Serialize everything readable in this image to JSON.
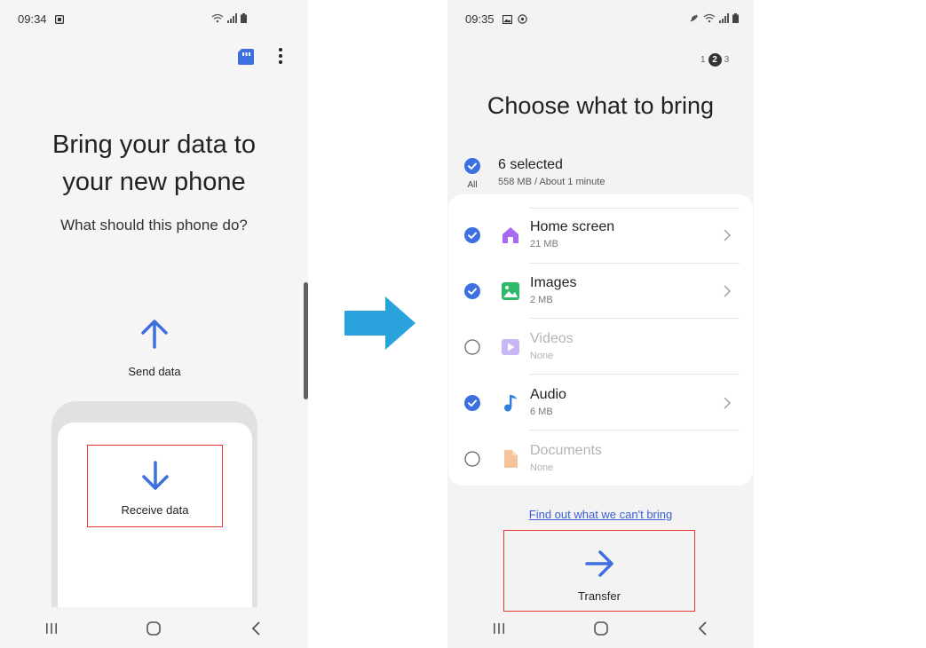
{
  "left_phone": {
    "status_time": "09:34",
    "title": "Bring your data to\nyour new phone",
    "subtitle": "What should this phone do?",
    "send_label": "Send data",
    "receive_label": "Receive data",
    "icons": [
      "sd-card-icon",
      "more-vert-icon",
      "arrow-up-icon",
      "arrow-down-icon"
    ]
  },
  "right_phone": {
    "status_time": "09:35",
    "steps": [
      "1",
      "2",
      "3"
    ],
    "current_step": "2",
    "title": "Choose what to bring",
    "all_label": "All",
    "selected_title": "6 selected",
    "selected_sub": "558 MB / About 1 minute",
    "items": [
      {
        "name": "Home screen",
        "size": "21 MB",
        "checked": true,
        "icon": "home-icon"
      },
      {
        "name": "Images",
        "size": "2 MB",
        "checked": true,
        "icon": "image-icon"
      },
      {
        "name": "Videos",
        "size": "None",
        "checked": false,
        "icon": "video-icon"
      },
      {
        "name": "Audio",
        "size": "6 MB",
        "checked": true,
        "icon": "music-note-icon"
      },
      {
        "name": "Documents",
        "size": "None",
        "checked": false,
        "icon": "document-icon"
      }
    ],
    "find_link": "Find out what we can't bring",
    "transfer_label": "Transfer"
  },
  "colors": {
    "accent_blue": "#3d6fe0",
    "flow_arrow": "#2aa3dc",
    "highlight_red": "#e53935",
    "home_purple": "#a66bf0",
    "image_green": "#2eb86b",
    "video_purple": "#b59af0",
    "audio_blue": "#2d7fe0",
    "doc_orange": "#f5b88a"
  }
}
